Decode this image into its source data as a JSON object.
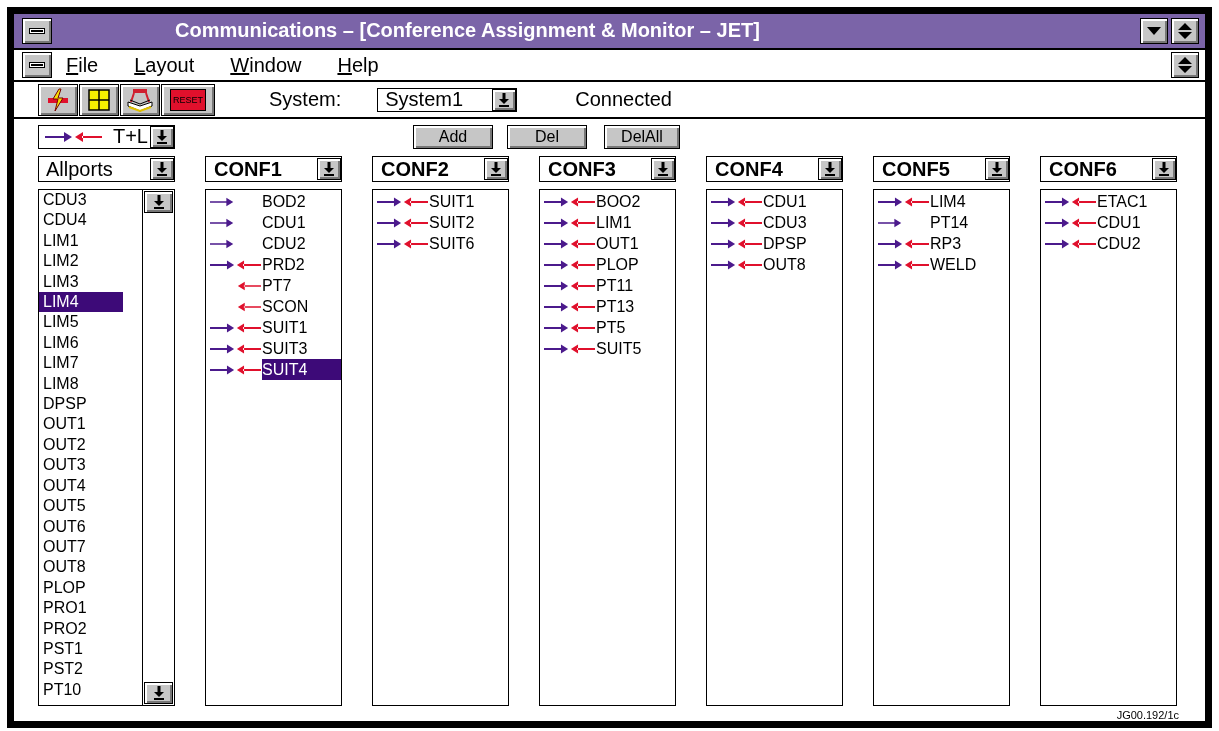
{
  "window": {
    "title": "Communications – [Conference Assignment & Monitor – JET]"
  },
  "menu": [
    {
      "label": "File"
    },
    {
      "label": "Layout"
    },
    {
      "label": "Window"
    },
    {
      "label": "Help"
    }
  ],
  "toolbar": {
    "tools": [
      {
        "kind": "lightning"
      },
      {
        "kind": "grid"
      },
      {
        "kind": "book"
      },
      {
        "kind": "reset",
        "label": "RESET"
      }
    ],
    "system_label": "System:",
    "system_select": {
      "value": "System1"
    },
    "status": "Connected"
  },
  "mode_select": {
    "value": "T+L"
  },
  "actions": [
    "Add",
    "Del",
    "DelAll"
  ],
  "port_list": {
    "select": "Allports",
    "items": [
      {
        "label": "CDU3",
        "selected": false
      },
      {
        "label": "CDU4",
        "selected": false
      },
      {
        "label": "LIM1",
        "selected": false
      },
      {
        "label": "LIM2",
        "selected": false
      },
      {
        "label": "LIM3",
        "selected": false
      },
      {
        "label": "LIM4",
        "selected": true
      },
      {
        "label": "LIM5",
        "selected": false
      },
      {
        "label": "LIM6",
        "selected": false
      },
      {
        "label": "LIM7",
        "selected": false
      },
      {
        "label": "LIM8",
        "selected": false
      },
      {
        "label": "DPSP",
        "selected": false
      },
      {
        "label": "OUT1",
        "selected": false
      },
      {
        "label": "OUT2",
        "selected": false
      },
      {
        "label": "OUT3",
        "selected": false
      },
      {
        "label": "OUT4",
        "selected": false
      },
      {
        "label": "OUT5",
        "selected": false
      },
      {
        "label": "OUT6",
        "selected": false
      },
      {
        "label": "OUT7",
        "selected": false
      },
      {
        "label": "OUT8",
        "selected": false
      },
      {
        "label": "PLOP",
        "selected": false
      },
      {
        "label": "PRO1",
        "selected": false
      },
      {
        "label": "PRO2",
        "selected": false
      },
      {
        "label": "PST1",
        "selected": false
      },
      {
        "label": "PST2",
        "selected": false
      },
      {
        "label": "PT10",
        "selected": false
      }
    ]
  },
  "conferences": [
    {
      "name": "CONF1",
      "ports": [
        {
          "name": "BOD2",
          "talk": true,
          "listen": false,
          "selected": false
        },
        {
          "name": "CDU1",
          "talk": true,
          "listen": false,
          "selected": false
        },
        {
          "name": "CDU2",
          "talk": true,
          "listen": false,
          "selected": false
        },
        {
          "name": "PRD2",
          "talk": true,
          "listen": true,
          "selected": false
        },
        {
          "name": "PT7",
          "talk": false,
          "listen": true,
          "selected": false
        },
        {
          "name": "SCON",
          "talk": false,
          "listen": true,
          "selected": false
        },
        {
          "name": "SUIT1",
          "talk": true,
          "listen": true,
          "selected": false
        },
        {
          "name": "SUIT3",
          "talk": true,
          "listen": true,
          "selected": false
        },
        {
          "name": "SUIT4",
          "talk": true,
          "listen": true,
          "selected": true
        }
      ]
    },
    {
      "name": "CONF2",
      "ports": [
        {
          "name": "SUIT1",
          "talk": true,
          "listen": true,
          "selected": false
        },
        {
          "name": "SUIT2",
          "talk": true,
          "listen": true,
          "selected": false
        },
        {
          "name": "SUIT6",
          "talk": true,
          "listen": true,
          "selected": false
        }
      ]
    },
    {
      "name": "CONF3",
      "ports": [
        {
          "name": "BOO2",
          "talk": true,
          "listen": true,
          "selected": false
        },
        {
          "name": "LIM1",
          "talk": true,
          "listen": true,
          "selected": false
        },
        {
          "name": "OUT1",
          "talk": true,
          "listen": true,
          "selected": false
        },
        {
          "name": "PLOP",
          "talk": true,
          "listen": true,
          "selected": false
        },
        {
          "name": "PT11",
          "talk": true,
          "listen": true,
          "selected": false
        },
        {
          "name": "PT13",
          "talk": true,
          "listen": true,
          "selected": false
        },
        {
          "name": "PT5",
          "talk": true,
          "listen": true,
          "selected": false
        },
        {
          "name": "SUIT5",
          "talk": true,
          "listen": true,
          "selected": false
        }
      ]
    },
    {
      "name": "CONF4",
      "ports": [
        {
          "name": "CDU1",
          "talk": true,
          "listen": true,
          "selected": false
        },
        {
          "name": "CDU3",
          "talk": true,
          "listen": true,
          "selected": false
        },
        {
          "name": "DPSP",
          "talk": true,
          "listen": true,
          "selected": false
        },
        {
          "name": "OUT8",
          "talk": true,
          "listen": true,
          "selected": false
        }
      ]
    },
    {
      "name": "CONF5",
      "ports": [
        {
          "name": "LIM4",
          "talk": true,
          "listen": true,
          "selected": false
        },
        {
          "name": "PT14",
          "talk": true,
          "listen": false,
          "selected": false
        },
        {
          "name": "RP3",
          "talk": true,
          "listen": true,
          "selected": false
        },
        {
          "name": "WELD",
          "talk": true,
          "listen": true,
          "selected": false
        }
      ]
    },
    {
      "name": "CONF6",
      "ports": [
        {
          "name": "ETAC1",
          "talk": true,
          "listen": true,
          "selected": false
        },
        {
          "name": "CDU1",
          "talk": true,
          "listen": true,
          "selected": false
        },
        {
          "name": "CDU2",
          "talk": true,
          "listen": true,
          "selected": false
        }
      ]
    }
  ],
  "footer": {
    "code": "JG00.192/1c"
  }
}
